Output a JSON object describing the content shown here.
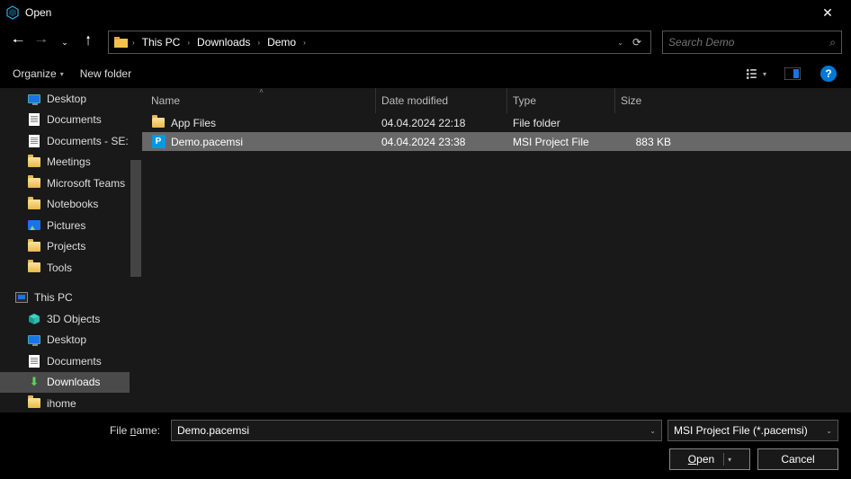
{
  "window": {
    "title": "Open"
  },
  "breadcrumb": {
    "segments": [
      "This PC",
      "Downloads",
      "Demo"
    ]
  },
  "search": {
    "placeholder": "Search Demo"
  },
  "toolbar": {
    "organize": "Organize",
    "new_folder": "New folder"
  },
  "sidebar": {
    "items": [
      {
        "label": "Desktop",
        "icon": "monitor"
      },
      {
        "label": "Documents",
        "icon": "doc"
      },
      {
        "label": "Documents - SE:",
        "icon": "doc"
      },
      {
        "label": "Meetings",
        "icon": "folder"
      },
      {
        "label": "Microsoft Teams",
        "icon": "folder"
      },
      {
        "label": "Notebooks",
        "icon": "folder"
      },
      {
        "label": "Pictures",
        "icon": "pic"
      },
      {
        "label": "Projects",
        "icon": "folder"
      },
      {
        "label": "Tools",
        "icon": "folder"
      }
    ],
    "root": {
      "label": "This PC",
      "icon": "pc"
    },
    "children": [
      {
        "label": "3D Objects",
        "icon": "cube"
      },
      {
        "label": "Desktop",
        "icon": "monitor"
      },
      {
        "label": "Documents",
        "icon": "doc"
      },
      {
        "label": "Downloads",
        "icon": "download",
        "selected": true
      },
      {
        "label": "ihome",
        "icon": "folder"
      }
    ]
  },
  "columns": {
    "name": "Name",
    "date": "Date modified",
    "type": "Type",
    "size": "Size"
  },
  "files": [
    {
      "name": "App Files",
      "date": "04.04.2024 22:18",
      "type": "File folder",
      "size": "",
      "icon": "folder",
      "selected": false
    },
    {
      "name": "Demo.pacemsi",
      "date": "04.04.2024 23:38",
      "type": "MSI Project File",
      "size": "883 KB",
      "icon": "ext",
      "selected": true
    }
  ],
  "footer": {
    "filename_label_pre": "File ",
    "filename_label_u": "n",
    "filename_label_post": "ame:",
    "filename_value": "Demo.pacemsi",
    "filter": "MSI Project File (*.pacemsi)",
    "open_u": "O",
    "open_rest": "pen",
    "cancel": "Cancel"
  },
  "icons": {
    "ext_letter": "P"
  }
}
